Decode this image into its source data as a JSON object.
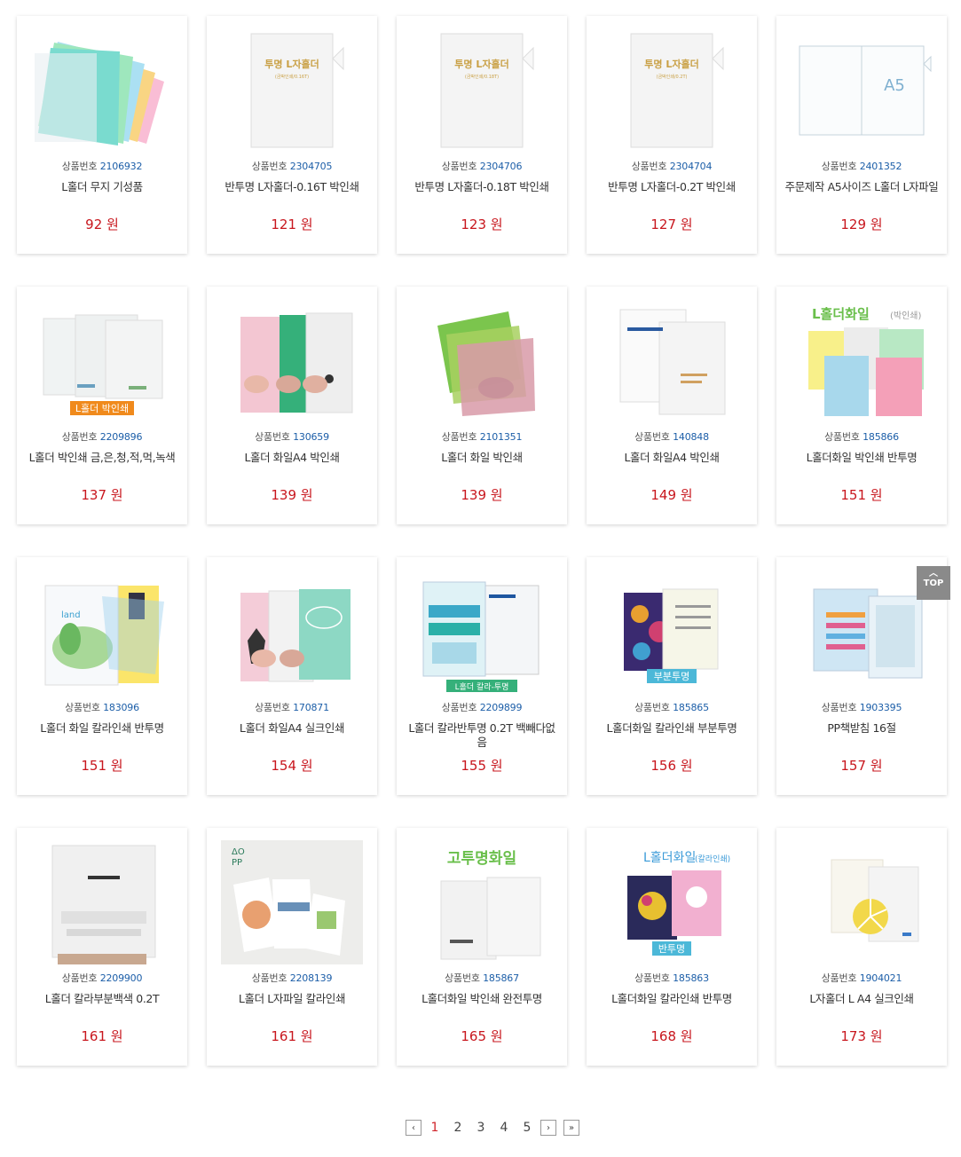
{
  "product_code_label": "상품번호",
  "products": [
    {
      "code": "2106932",
      "name": "L홀더 무지 기성품",
      "price": "92 원"
    },
    {
      "code": "2304705",
      "name": "반투명 L자홀더-0.16T 박인쇄",
      "price": "121 원",
      "img_title": "투명 L자홀더",
      "img_sub": "(금박인쇄/0.16T)"
    },
    {
      "code": "2304706",
      "name": "반투명 L자홀더-0.18T 박인쇄",
      "price": "123 원",
      "img_title": "투명 L자홀더",
      "img_sub": "(금박인쇄/0.18T)"
    },
    {
      "code": "2304704",
      "name": "반투명 L자홀더-0.2T 박인쇄",
      "price": "127 원",
      "img_title": "투명 L자홀더",
      "img_sub": "(금박인쇄/0.2T)"
    },
    {
      "code": "2401352",
      "name": "주문제작 A5사이즈 L홀더 L자파일",
      "price": "129 원",
      "img_title": "A5"
    },
    {
      "code": "2209896",
      "name": "L홀더 박인쇄 금,은,청,적,먹,녹색",
      "price": "137 원",
      "img_badge": "L홀더 박인쇄"
    },
    {
      "code": "130659",
      "name": "L홀더 화일A4 박인쇄",
      "price": "139 원"
    },
    {
      "code": "2101351",
      "name": "L홀더 화일 박인쇄",
      "price": "139 원"
    },
    {
      "code": "140848",
      "name": "L홀더 화일A4 박인쇄",
      "price": "149 원"
    },
    {
      "code": "185866",
      "name": "L홀더화일 박인쇄 반투명",
      "price": "151 원",
      "img_title": "L홀더화일",
      "img_sub": "(박인쇄)"
    },
    {
      "code": "183096",
      "name": "L홀더 화일 칼라인쇄 반투명",
      "price": "151 원"
    },
    {
      "code": "170871",
      "name": "L홀더 화일A4 실크인쇄",
      "price": "154 원"
    },
    {
      "code": "2209899",
      "name": "L홀더 칼라반투명 0.2T 백빼다없음",
      "price": "155 원",
      "img_badge": "L홀더 칼라-투명"
    },
    {
      "code": "185865",
      "name": "L홀더화일 칼라인쇄 부분투명",
      "price": "156 원",
      "img_badge": "부분투명"
    },
    {
      "code": "1903395",
      "name": "PP책받침 16절",
      "price": "157 원"
    },
    {
      "code": "2209900",
      "name": "L홀더 칼라부분백색 0.2T",
      "price": "161 원"
    },
    {
      "code": "2208139",
      "name": "L홀더 L자파일 칼라인쇄",
      "price": "161 원"
    },
    {
      "code": "185867",
      "name": "L홀더화일 박인쇄 완전투명",
      "price": "165 원",
      "img_title": "고투명화일"
    },
    {
      "code": "185863",
      "name": "L홀더화일 칼라인쇄 반투명",
      "price": "168 원",
      "img_title": "L홀더화일",
      "img_sub": "(칼라인쇄)",
      "img_badge": "반투명"
    },
    {
      "code": "1904021",
      "name": "L자홀더 L A4 실크인쇄",
      "price": "173 원"
    }
  ],
  "top_button": {
    "label": "TOP"
  },
  "pagination": {
    "pages": [
      "1",
      "2",
      "3",
      "4",
      "5"
    ],
    "current": "1",
    "prev": "‹",
    "next": "›",
    "last": "»"
  },
  "colors": {
    "price": "#c8161d",
    "code": "#1c5ea8",
    "active_page": "#d0252b"
  }
}
